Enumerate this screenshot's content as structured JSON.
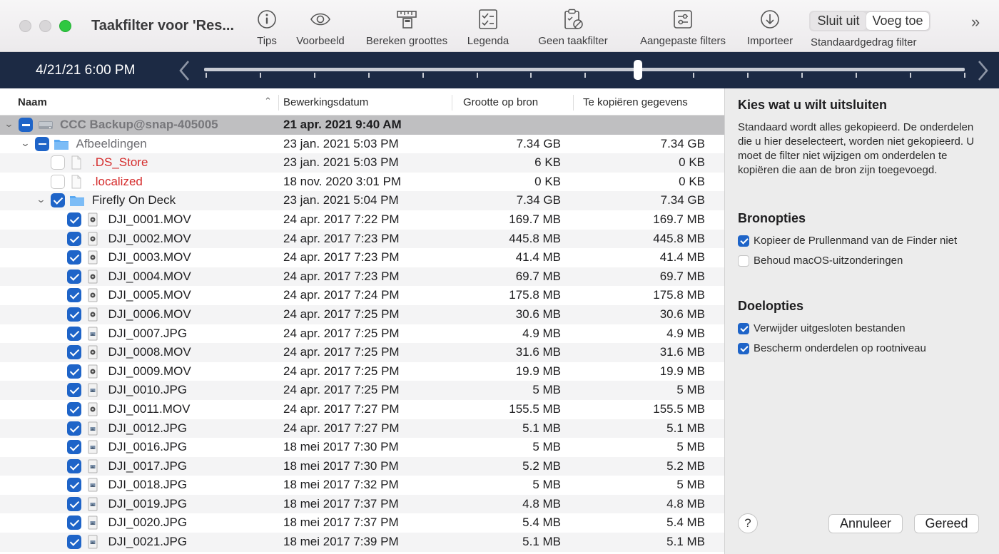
{
  "window": {
    "title": "Taakfilter voor 'Res..."
  },
  "toolbar": {
    "buttons": [
      {
        "label": "Tips",
        "icon": "lightbulb-info-icon"
      },
      {
        "label": "Voorbeeld",
        "icon": "eye-icon"
      },
      {
        "label": "Bereken groottes",
        "icon": "ruler-calculator-icon"
      },
      {
        "label": "Legenda",
        "icon": "checklist-icon"
      },
      {
        "label": "Geen taakfilter",
        "icon": "clipboard-no-filter-icon"
      },
      {
        "label": "Aangepaste filters",
        "icon": "sliders-icon"
      },
      {
        "label": "Importeer",
        "icon": "download-icon"
      }
    ],
    "segment": {
      "option1": "Sluit uit",
      "option2": "Voeg toe",
      "selected": "Voeg toe",
      "label": "Standaardgedrag filter"
    },
    "more_icon": "chevron-double-right-icon"
  },
  "timeline": {
    "date": "4/21/21 6:00 PM"
  },
  "table": {
    "columns": {
      "name": "Naam",
      "date": "Bewerkingsdatum",
      "source_size": "Grootte op bron",
      "copy_size": "Te kopiëren gegevens"
    },
    "rows": [
      {
        "name": "CCC Backup@snap-405005",
        "date": "21 apr. 2021 9:40 AM",
        "src": "",
        "cpy": "",
        "level": 0,
        "disclosure": true,
        "check": "mixed",
        "icon": "disk",
        "style": "bold"
      },
      {
        "name": "Afbeeldingen",
        "date": "23 jan. 2021 5:03 PM",
        "src": "7.34 GB",
        "cpy": "7.34 GB",
        "level": 1,
        "disclosure": true,
        "check": "mixed",
        "icon": "folder",
        "style": "grey"
      },
      {
        "name": ".DS_Store",
        "date": "23 jan. 2021 5:03 PM",
        "src": "6 KB",
        "cpy": "0 KB",
        "level": 2,
        "disclosure": false,
        "check": "unchecked",
        "icon": "doc",
        "style": "red"
      },
      {
        "name": ".localized",
        "date": "18 nov. 2020 3:01 PM",
        "src": "0 KB",
        "cpy": "0 KB",
        "level": 2,
        "disclosure": false,
        "check": "unchecked",
        "icon": "doc",
        "style": "red"
      },
      {
        "name": "Firefly On Deck",
        "date": "23 jan. 2021 5:04 PM",
        "src": "7.34 GB",
        "cpy": "7.34 GB",
        "level": 2,
        "disclosure": true,
        "check": "checked",
        "icon": "folder",
        "style": "normal"
      },
      {
        "name": "DJI_0001.MOV",
        "date": "24 apr. 2017 7:22 PM",
        "src": "169.7 MB",
        "cpy": "169.7 MB",
        "level": 3,
        "disclosure": false,
        "check": "checked",
        "icon": "movie",
        "style": "normal"
      },
      {
        "name": "DJI_0002.MOV",
        "date": "24 apr. 2017 7:23 PM",
        "src": "445.8 MB",
        "cpy": "445.8 MB",
        "level": 3,
        "disclosure": false,
        "check": "checked",
        "icon": "movie",
        "style": "normal"
      },
      {
        "name": "DJI_0003.MOV",
        "date": "24 apr. 2017 7:23 PM",
        "src": "41.4 MB",
        "cpy": "41.4 MB",
        "level": 3,
        "disclosure": false,
        "check": "checked",
        "icon": "movie",
        "style": "normal"
      },
      {
        "name": "DJI_0004.MOV",
        "date": "24 apr. 2017 7:23 PM",
        "src": "69.7 MB",
        "cpy": "69.7 MB",
        "level": 3,
        "disclosure": false,
        "check": "checked",
        "icon": "movie",
        "style": "normal"
      },
      {
        "name": "DJI_0005.MOV",
        "date": "24 apr. 2017 7:24 PM",
        "src": "175.8 MB",
        "cpy": "175.8 MB",
        "level": 3,
        "disclosure": false,
        "check": "checked",
        "icon": "movie",
        "style": "normal"
      },
      {
        "name": "DJI_0006.MOV",
        "date": "24 apr. 2017 7:25 PM",
        "src": "30.6 MB",
        "cpy": "30.6 MB",
        "level": 3,
        "disclosure": false,
        "check": "checked",
        "icon": "movie",
        "style": "normal"
      },
      {
        "name": "DJI_0007.JPG",
        "date": "24 apr. 2017 7:25 PM",
        "src": "4.9 MB",
        "cpy": "4.9 MB",
        "level": 3,
        "disclosure": false,
        "check": "checked",
        "icon": "image",
        "style": "normal"
      },
      {
        "name": "DJI_0008.MOV",
        "date": "24 apr. 2017 7:25 PM",
        "src": "31.6 MB",
        "cpy": "31.6 MB",
        "level": 3,
        "disclosure": false,
        "check": "checked",
        "icon": "movie",
        "style": "normal"
      },
      {
        "name": "DJI_0009.MOV",
        "date": "24 apr. 2017 7:25 PM",
        "src": "19.9 MB",
        "cpy": "19.9 MB",
        "level": 3,
        "disclosure": false,
        "check": "checked",
        "icon": "movie",
        "style": "normal"
      },
      {
        "name": "DJI_0010.JPG",
        "date": "24 apr. 2017 7:25 PM",
        "src": "5 MB",
        "cpy": "5 MB",
        "level": 3,
        "disclosure": false,
        "check": "checked",
        "icon": "image",
        "style": "normal"
      },
      {
        "name": "DJI_0011.MOV",
        "date": "24 apr. 2017 7:27 PM",
        "src": "155.5 MB",
        "cpy": "155.5 MB",
        "level": 3,
        "disclosure": false,
        "check": "checked",
        "icon": "movie",
        "style": "normal"
      },
      {
        "name": "DJI_0012.JPG",
        "date": "24 apr. 2017 7:27 PM",
        "src": "5.1 MB",
        "cpy": "5.1 MB",
        "level": 3,
        "disclosure": false,
        "check": "checked",
        "icon": "image",
        "style": "normal"
      },
      {
        "name": "DJI_0016.JPG",
        "date": "18 mei 2017 7:30 PM",
        "src": "5 MB",
        "cpy": "5 MB",
        "level": 3,
        "disclosure": false,
        "check": "checked",
        "icon": "image",
        "style": "normal"
      },
      {
        "name": "DJI_0017.JPG",
        "date": "18 mei 2017 7:30 PM",
        "src": "5.2 MB",
        "cpy": "5.2 MB",
        "level": 3,
        "disclosure": false,
        "check": "checked",
        "icon": "image",
        "style": "normal"
      },
      {
        "name": "DJI_0018.JPG",
        "date": "18 mei 2017 7:32 PM",
        "src": "5 MB",
        "cpy": "5 MB",
        "level": 3,
        "disclosure": false,
        "check": "checked",
        "icon": "image",
        "style": "normal"
      },
      {
        "name": "DJI_0019.JPG",
        "date": "18 mei 2017 7:37 PM",
        "src": "4.8 MB",
        "cpy": "4.8 MB",
        "level": 3,
        "disclosure": false,
        "check": "checked",
        "icon": "image",
        "style": "normal"
      },
      {
        "name": "DJI_0020.JPG",
        "date": "18 mei 2017 7:37 PM",
        "src": "5.4 MB",
        "cpy": "5.4 MB",
        "level": 3,
        "disclosure": false,
        "check": "checked",
        "icon": "image",
        "style": "normal"
      },
      {
        "name": "DJI_0021.JPG",
        "date": "18 mei 2017 7:39 PM",
        "src": "5.1 MB",
        "cpy": "5.1 MB",
        "level": 3,
        "disclosure": false,
        "check": "checked",
        "icon": "image",
        "style": "normal"
      }
    ]
  },
  "panel": {
    "title": "Kies wat u wilt uitsluiten",
    "description": "Standaard wordt alles gekopieerd. De onderdelen die u hier deselecteert, worden niet gekopieerd. U moet de filter niet wijzigen om onderdelen te kopiëren die aan de bron zijn toegevoegd.",
    "source_heading": "Bronopties",
    "source_options": [
      {
        "label": "Kopieer de Prullenmand van de Finder niet",
        "checked": true
      },
      {
        "label": "Behoud macOS-uitzonderingen",
        "checked": false
      }
    ],
    "dest_heading": "Doelopties",
    "dest_options": [
      {
        "label": "Verwijder uitgesloten bestanden",
        "checked": true
      },
      {
        "label": "Bescherm onderdelen op rootniveau",
        "checked": true
      }
    ],
    "help_label": "?",
    "cancel_label": "Annuleer",
    "done_label": "Gereed"
  },
  "colors": {
    "accent": "#1e64c8",
    "timeline_bg": "#1c2a44",
    "excluded_text": "#d52c2c",
    "selected_row": "#bfbfc1"
  }
}
